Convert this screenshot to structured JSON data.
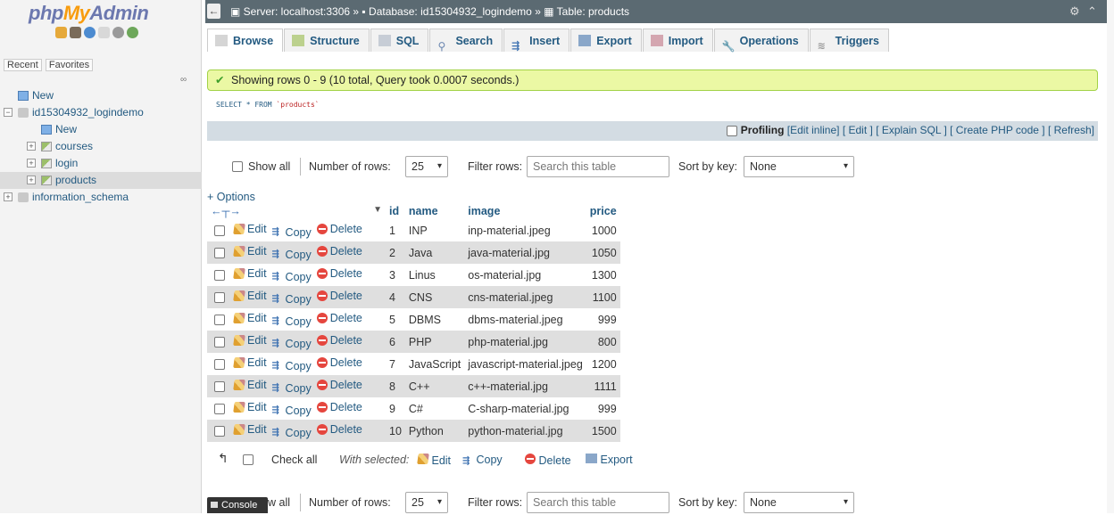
{
  "nav": {
    "logo_php": "php",
    "logo_my": "My",
    "logo_admin": "Admin",
    "recent": "Recent",
    "favorites": "Favorites",
    "tree": [
      {
        "label": "New",
        "level": 0,
        "type": "new"
      },
      {
        "label": "id15304932_logindemo",
        "level": 0,
        "type": "db"
      },
      {
        "label": "New",
        "level": 1,
        "type": "new"
      },
      {
        "label": "courses",
        "level": 1,
        "type": "table"
      },
      {
        "label": "login",
        "level": 1,
        "type": "table"
      },
      {
        "label": "products",
        "level": 1,
        "type": "table",
        "selected": true
      },
      {
        "label": "information_schema",
        "level": 0,
        "type": "db"
      }
    ]
  },
  "breadcrumb": {
    "server": "Server: localhost:3306",
    "database": "Database: id15304932_logindemo",
    "table": "Table: products"
  },
  "tabs": [
    "Browse",
    "Structure",
    "SQL",
    "Search",
    "Insert",
    "Export",
    "Import",
    "Operations",
    "Triggers"
  ],
  "success_message": "Showing rows 0 - 9 (10 total, Query took 0.0007 seconds.)",
  "sql": {
    "keyword": "SELECT * FROM",
    "table": "`products`"
  },
  "profiling": {
    "label": "Profiling",
    "links": [
      "[Edit inline]",
      "[ Edit ]",
      "[ Explain SQL ]",
      "[ Create PHP code ]",
      "[ Refresh]"
    ]
  },
  "controls": {
    "show_all": "Show all",
    "number_of_rows_label": "Number of rows:",
    "number_of_rows_value": "25",
    "filter_rows_label": "Filter rows:",
    "filter_placeholder": "Search this table",
    "sort_by_key_label": "Sort by key:",
    "sort_by_key_value": "None"
  },
  "options_label": "+ Options",
  "table": {
    "columns": [
      "id",
      "name",
      "image",
      "price"
    ],
    "actions": {
      "edit": "Edit",
      "copy": "Copy",
      "delete": "Delete"
    },
    "rows": [
      {
        "id": "1",
        "name": "INP",
        "image": "inp-material.jpeg",
        "price": "1000"
      },
      {
        "id": "2",
        "name": "Java",
        "image": "java-material.jpg",
        "price": "1050"
      },
      {
        "id": "3",
        "name": "Linus",
        "image": "os-material.jpg",
        "price": "1300"
      },
      {
        "id": "4",
        "name": "CNS",
        "image": "cns-material.jpeg",
        "price": "1100"
      },
      {
        "id": "5",
        "name": "DBMS",
        "image": "dbms-material.jpeg",
        "price": "999"
      },
      {
        "id": "6",
        "name": "PHP",
        "image": "php-material.jpg",
        "price": "800"
      },
      {
        "id": "7",
        "name": "JavaScript",
        "image": "javascript-material.jpeg",
        "price": "1200"
      },
      {
        "id": "8",
        "name": "C++",
        "image": "c++-material.jpg",
        "price": "1111"
      },
      {
        "id": "9",
        "name": "C#",
        "image": "C-sharp-material.jpg",
        "price": "999"
      },
      {
        "id": "10",
        "name": "Python",
        "image": "python-material.jpg",
        "price": "1500"
      }
    ]
  },
  "bottom": {
    "check_all": "Check all",
    "with_selected": "With selected:",
    "edit": "Edit",
    "copy": "Copy",
    "delete": "Delete",
    "export": "Export"
  },
  "console_label": "Console",
  "bottom_show_all_partial": "w all"
}
